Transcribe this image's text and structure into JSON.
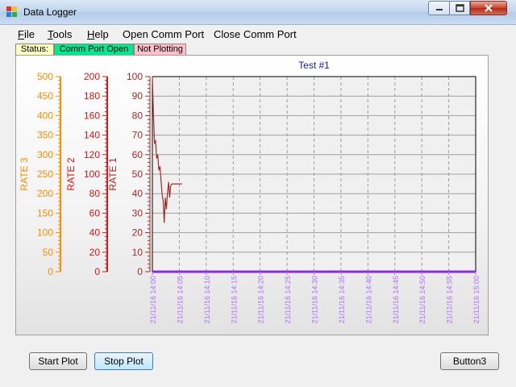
{
  "window": {
    "title": "Data Logger"
  },
  "menu": {
    "file": "File",
    "tools": "Tools",
    "help": "Help",
    "open_port": "Open Comm Port",
    "close_port": "Close Comm Port"
  },
  "status": {
    "label": "Status:",
    "port": "Comm Port Open",
    "plot": "Not Plotting"
  },
  "buttons": {
    "start": "Start Plot",
    "stop": "Stop Plot",
    "b3": "Button3"
  },
  "colors": {
    "rate3": "#ff8c00",
    "rate2": "#dc1414",
    "rate1": "#a52a2a",
    "x_labels": "#b070ff",
    "zero_line": "#8a2be2",
    "status_label": "#ffffc0",
    "status_port": "#00e890",
    "status_plot": "#ffc0cb"
  },
  "chart_data": {
    "type": "line",
    "title": "Test #1",
    "x_tick_labels": [
      "21/11/16 14:00",
      "21/11/16 14:05",
      "21/11/16 14:10",
      "21/11/16 14:15",
      "21/11/16 14:20",
      "21/11/16 14:25",
      "21/11/16 14:30",
      "21/11/16 14:35",
      "21/11/16 14:40",
      "21/11/16 14:45",
      "21/11/16 14:50",
      "21/11/16 14:55",
      "21/11/16 15:00"
    ],
    "xlim": [
      0,
      60
    ],
    "axes": [
      {
        "label": "RATE 1",
        "ylim": [
          0,
          100
        ],
        "ticks": [
          0,
          10,
          20,
          30,
          40,
          50,
          60,
          70,
          80,
          90,
          100
        ]
      },
      {
        "label": "RATE 2",
        "ylim": [
          0,
          200
        ],
        "ticks": [
          0,
          20,
          40,
          60,
          80,
          100,
          120,
          140,
          160,
          180,
          200
        ]
      },
      {
        "label": "RATE 3",
        "ylim": [
          0,
          500
        ],
        "ticks": [
          0,
          50,
          100,
          150,
          200,
          250,
          300,
          350,
          400,
          450,
          500
        ]
      }
    ],
    "grid": true,
    "series": [
      {
        "axis": 0,
        "points": [
          [
            0,
            100
          ],
          [
            0.2,
            80
          ],
          [
            0.4,
            66
          ],
          [
            0.6,
            67
          ],
          [
            0.8,
            58
          ],
          [
            1.0,
            60
          ],
          [
            1.2,
            52
          ],
          [
            1.4,
            54
          ],
          [
            1.6,
            47
          ],
          [
            1.8,
            40
          ],
          [
            2.0,
            36
          ],
          [
            2.2,
            25
          ],
          [
            2.4,
            38
          ],
          [
            2.6,
            32
          ],
          [
            2.8,
            40
          ],
          [
            3.0,
            46
          ],
          [
            3.2,
            38
          ],
          [
            3.4,
            44
          ],
          [
            3.6,
            45
          ],
          [
            4.0,
            45
          ],
          [
            5.5,
            45
          ]
        ]
      }
    ]
  }
}
